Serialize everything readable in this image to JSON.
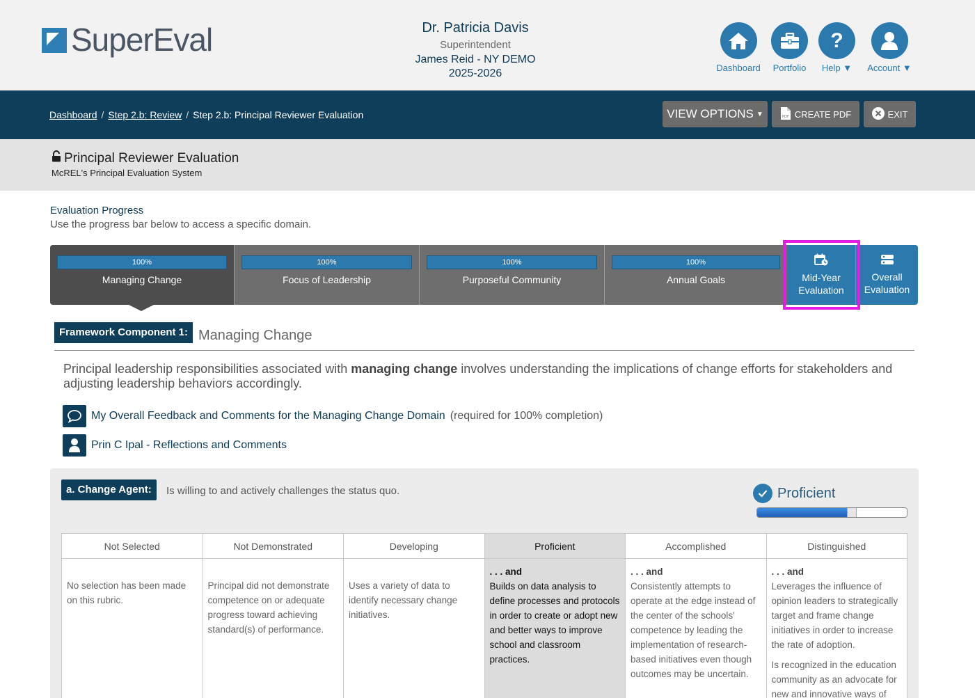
{
  "header": {
    "logo_text": "SuperEval",
    "user_name": "Dr. Patricia Davis",
    "user_role": "Superintendent",
    "user_org": "James Reid - NY DEMO",
    "user_year": "2025-2026",
    "nav": [
      {
        "label": "Dashboard",
        "icon": "home-icon"
      },
      {
        "label": "Portfolio",
        "icon": "briefcase-icon"
      },
      {
        "label": "Help",
        "icon": "question-icon"
      },
      {
        "label": "Account",
        "icon": "user-icon"
      }
    ]
  },
  "toolbar": {
    "breadcrumbs": [
      "Dashboard",
      "Step 2.b: Review",
      "Step 2.b: Principal Reviewer Evaluation"
    ],
    "separator": "/",
    "view_options": "VIEW OPTIONS",
    "create_pdf": "CREATE PDF",
    "exit": "EXIT"
  },
  "page": {
    "title": "Principal Reviewer Evaluation",
    "subtitle": "McREL's Principal Evaluation System"
  },
  "progress": {
    "title": "Evaluation Progress",
    "subtitle": "Use the progress bar below to access a specific domain.",
    "domains": [
      {
        "label": "Managing Change",
        "percent": "100%"
      },
      {
        "label": "Focus of Leadership",
        "percent": "100%"
      },
      {
        "label": "Purposeful Community",
        "percent": "100%"
      },
      {
        "label": "Annual Goals",
        "percent": "100%"
      }
    ],
    "midyear": {
      "line1": "Mid-Year",
      "line2": "Evaluation"
    },
    "overall": {
      "line1": "Overall",
      "line2": "Evaluation"
    }
  },
  "framework": {
    "badge": "Framework Component 1:",
    "name": "Managing Change",
    "desc_pre": "Principal leadership responsibilities associated with ",
    "desc_bold": "managing change",
    "desc_post": " involves understanding the implications of change efforts for stakeholders and adjusting leadership behaviors accordingly.",
    "feedback_link": "My Overall Feedback and Comments for the Managing Change Domain",
    "feedback_note": "(required for 100% completion)",
    "reflections_link": "Prin C Ipal - Reflections and Comments"
  },
  "rubric": {
    "element_badge": "a. Change Agent:",
    "element_text": "Is willing to and actively challenges the status quo.",
    "rating_label": "Proficient",
    "rating_level": 0.6,
    "columns": [
      "Not Selected",
      "Not Demonstrated",
      "Developing",
      "Proficient",
      "Accomplished",
      "Distinguished"
    ],
    "and_label": ". . . and",
    "cells": [
      "No selection has been made on this rubric.",
      "Principal did not demonstrate competence on or adequate progress toward achieving standard(s) of performance.",
      "Uses a variety of data to identify necessary change initiatives.",
      "Builds on data analysis to define processes and protocols in order to create or adopt new and better ways to improve school and classroom practices.",
      "Consistently attempts to operate at the edge instead of the center of the schools' competence by leading the implementation of research-based initiatives even though outcomes may be uncertain.",
      "Leverages the influence of opinion leaders to strategically target and frame change initiatives in order to increase the rate of adoption."
    ],
    "distinguished_extra": "Is recognized in the education community as an advocate for new and innovative ways of"
  }
}
